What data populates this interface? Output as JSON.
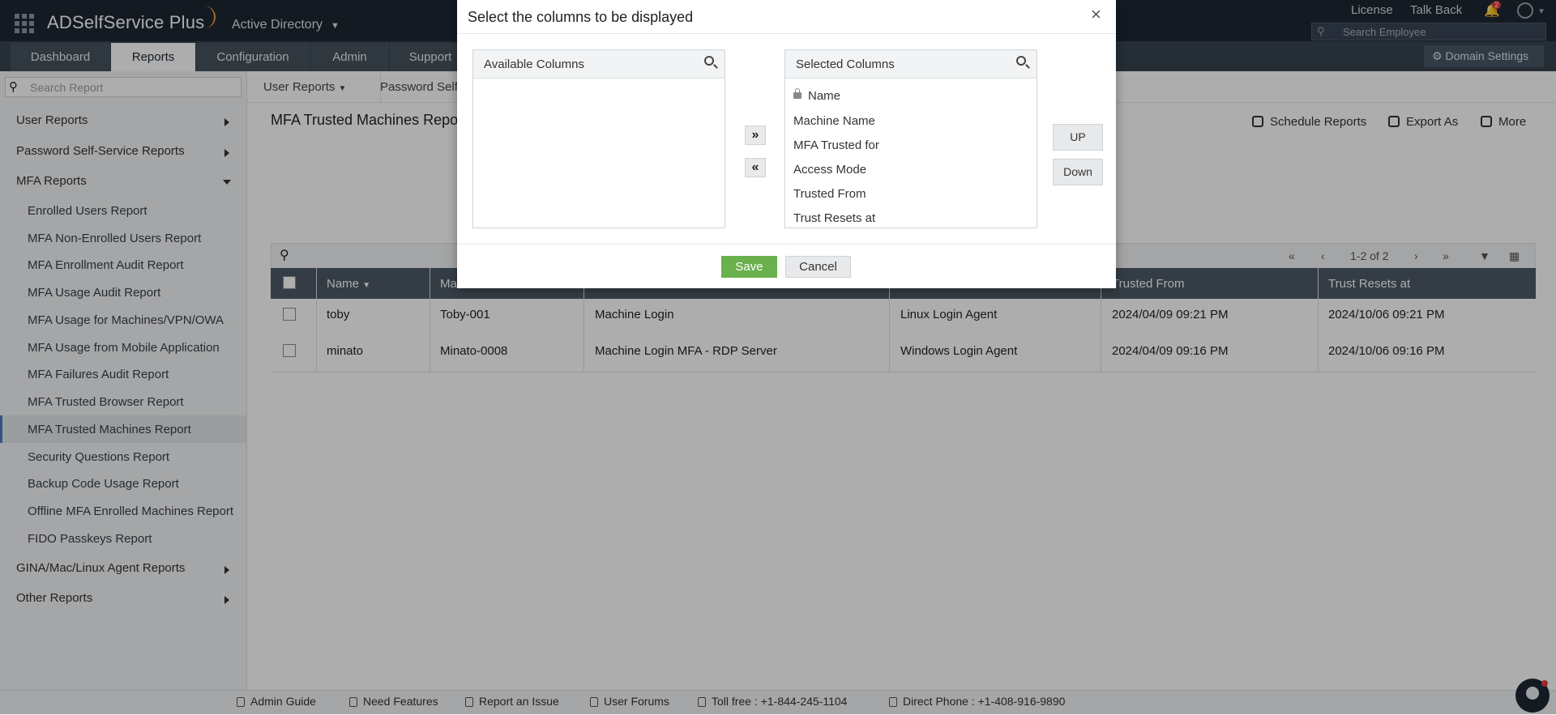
{
  "header": {
    "brand": "ADSelfService Plus",
    "directory": "Active Directory",
    "links": [
      "License",
      "Talk Back"
    ],
    "notif_count": "2",
    "search_placeholder": "Search Employee",
    "domain_settings": "Domain Settings",
    "tabs": [
      "Dashboard",
      "Reports",
      "Configuration",
      "Admin",
      "Support"
    ]
  },
  "sidebar": {
    "search_placeholder": "Search Report",
    "categories": {
      "user": "User Reports",
      "password": "Password Self-Service Reports",
      "mfa": "MFA Reports",
      "gina": "GINA/Mac/Linux Agent Reports",
      "other": "Other Reports"
    },
    "mfa_items": [
      "Enrolled Users Report",
      "MFA Non-Enrolled Users Report",
      "MFA Enrollment Audit Report",
      "MFA Usage Audit Report",
      "MFA Usage for Machines/VPN/OWA",
      "MFA Usage from Mobile Application",
      "MFA Failures Audit Report",
      "MFA Trusted Browser Report",
      "MFA Trusted Machines Report",
      "Security Questions Report",
      "Backup Code Usage Report",
      "Offline MFA Enrolled Machines Report",
      "FIDO Passkeys Report"
    ]
  },
  "subbar": {
    "user_reports": "User Reports",
    "password_self": "Password Self"
  },
  "report": {
    "title": "MFA Trusted Machines Report",
    "actions": [
      "Schedule Reports",
      "Export As",
      "More"
    ],
    "pagination": "1-2 of 2",
    "columns": [
      "Name",
      "Ma",
      "Trusted From",
      "Trust Resets at"
    ],
    "rows": [
      {
        "name": "toby",
        "machine": "Toby-001",
        "trusted_for": "Machine Login",
        "access_mode": "Linux Login Agent",
        "trusted_from": "2024/04/09 09:21 PM",
        "resets": "2024/10/06 09:21 PM"
      },
      {
        "name": "minato",
        "machine": "Minato-0008",
        "trusted_for": "Machine Login MFA - RDP Server",
        "access_mode": "Windows Login Agent",
        "trusted_from": "2024/04/09 09:16 PM",
        "resets": "2024/10/06 09:16 PM"
      }
    ]
  },
  "footer": {
    "admin_guide": "Admin Guide",
    "need_features": "Need Features",
    "report_issue": "Report an Issue",
    "user_forums": "User Forums",
    "toll_free": "Toll free : +1-844-245-1104",
    "direct_phone": "Direct Phone : +1-408-916-9890"
  },
  "modal": {
    "title": "Select the columns to be displayed",
    "available_header": "Available Columns",
    "selected_header": "Selected Columns",
    "selected_items": [
      "Name",
      "Machine Name",
      "MFA Trusted for",
      "Access Mode",
      "Trusted From",
      "Trust Resets at"
    ],
    "move_right": "»",
    "move_left": "«",
    "up": "UP",
    "down": "Down",
    "save": "Save",
    "cancel": "Cancel",
    "close": "×"
  }
}
